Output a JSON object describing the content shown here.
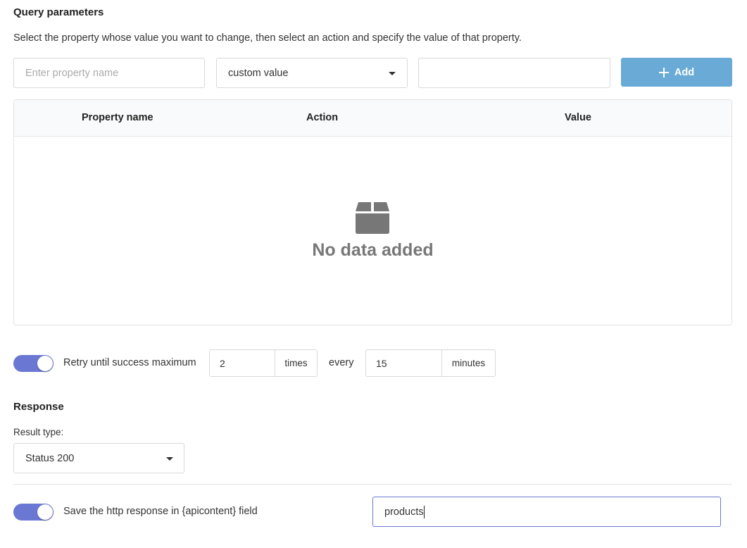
{
  "query_parameters": {
    "title": "Query parameters",
    "description": "Select the property whose value you want to change, then select an action and specify the value of that property.",
    "property_input_placeholder": "Enter property name",
    "action_select_value": "custom value",
    "value_input_value": "",
    "add_button_label": "Add",
    "table": {
      "columns": [
        "Property name",
        "Action",
        "Value"
      ],
      "rows": [],
      "empty_text": "No data added"
    }
  },
  "retry": {
    "enabled": true,
    "label": "Retry until success maximum",
    "times_value": "2",
    "times_unit": "times",
    "every_label": "every",
    "interval_value": "15",
    "interval_unit": "minutes"
  },
  "response": {
    "title": "Response",
    "result_type_label": "Result type:",
    "result_type_value": "Status 200",
    "save_enabled": true,
    "save_label": "Save the http response in {apicontent} field",
    "save_field_value": "products"
  },
  "colors": {
    "accent": "#6b78d3",
    "add_button": "#6aaad6",
    "empty_icon": "#777777"
  },
  "icons": {
    "add": "plus-icon",
    "select": "chevron-down-icon",
    "empty": "box-icon"
  }
}
